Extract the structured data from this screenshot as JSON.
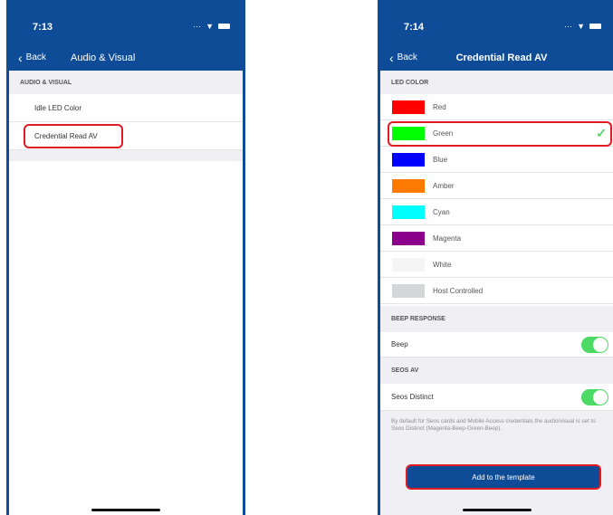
{
  "left": {
    "time": "7:13",
    "back_label": "Back",
    "title": "Audio & Visual",
    "section": "AUDIO & VISUAL",
    "items": [
      {
        "label": "Idle LED Color"
      },
      {
        "label": "Credential Read AV"
      }
    ]
  },
  "right": {
    "time": "7:14",
    "back_label": "Back",
    "title": "Credential Read AV",
    "led_section": "LED COLOR",
    "colors": [
      {
        "label": "Red",
        "swatch": "#ff0000",
        "selected": false
      },
      {
        "label": "Green",
        "swatch": "#00ff00",
        "selected": true
      },
      {
        "label": "Blue",
        "swatch": "#0000ff",
        "selected": false
      },
      {
        "label": "Amber",
        "swatch": "#ff7a00",
        "selected": false
      },
      {
        "label": "Cyan",
        "swatch": "#00ffff",
        "selected": false
      },
      {
        "label": "Magenta",
        "swatch": "#8b008b",
        "selected": false
      },
      {
        "label": "White",
        "swatch": "#f5f5f5",
        "selected": false
      },
      {
        "label": "Host Controlled",
        "swatch": "#d3d7da",
        "selected": false
      }
    ],
    "beep_section": "BEEP RESPONSE",
    "beep_label": "Beep",
    "beep_on": true,
    "seos_section": "SEOS AV",
    "seos_label": "Seos Distinct",
    "seos_on": true,
    "footnote": "By default for Seos cards and Mobile Access credentials the audio/visual is set to Seos Distinct (Magenta-Beep-Green-Beep).",
    "add_button": "Add to the template"
  },
  "colors": {
    "brand": "#0f4c97",
    "highlight": "#e21b23",
    "toggle": "#4cd964",
    "check": "#4cd964"
  }
}
